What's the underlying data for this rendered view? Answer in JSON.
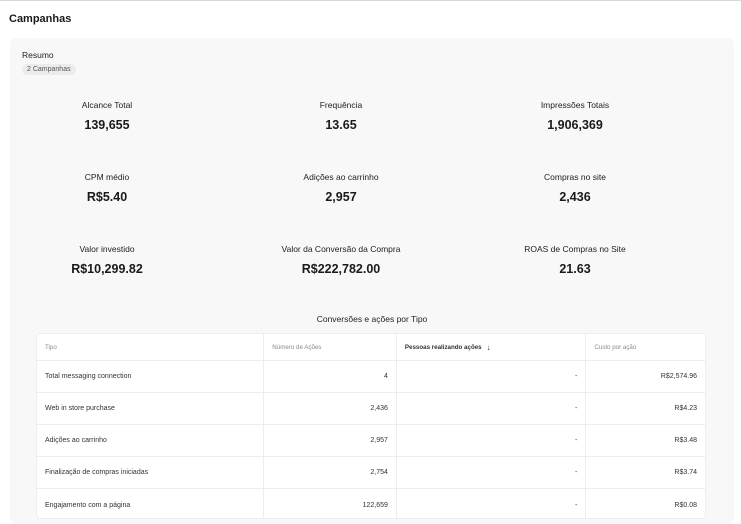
{
  "page": {
    "title": "Campanhas"
  },
  "summary": {
    "title": "Resumo",
    "badge": "2 Campanhas",
    "metrics": [
      {
        "label": "Alcance Total",
        "value": "139,655"
      },
      {
        "label": "Frequência",
        "value": "13.65"
      },
      {
        "label": "Impressões Totais",
        "value": "1,906,369"
      },
      {
        "label": "CPM médio",
        "value": "R$5.40"
      },
      {
        "label": "Adições ao carrinho",
        "value": "2,957"
      },
      {
        "label": "Compras no site",
        "value": "2,436"
      },
      {
        "label": "Valor investido",
        "value": "R$10,299.82"
      },
      {
        "label": "Valor da Conversão da Compra",
        "value": "R$222,782.00"
      },
      {
        "label": "ROAS de Compras no Site",
        "value": "21.63"
      }
    ]
  },
  "conversions": {
    "title": "Conversões e ações por Tipo",
    "columns": [
      "Tipo",
      "Número de Ações",
      "Pessoas realizando ações",
      "Custo por ação"
    ],
    "sort_icon": "arrow-down-icon",
    "rows": [
      [
        "Total messaging connection",
        "4",
        "-",
        "R$2,574.96"
      ],
      [
        "Web in store purchase",
        "2,436",
        "-",
        "R$4.23"
      ],
      [
        "Adições ao carrinho",
        "2,957",
        "-",
        "R$3.48"
      ],
      [
        "Finalização de compras iniciadas",
        "2,754",
        "-",
        "R$3.74"
      ],
      [
        "Engajamento com a página",
        "122,659",
        "-",
        "R$0.08"
      ]
    ]
  }
}
